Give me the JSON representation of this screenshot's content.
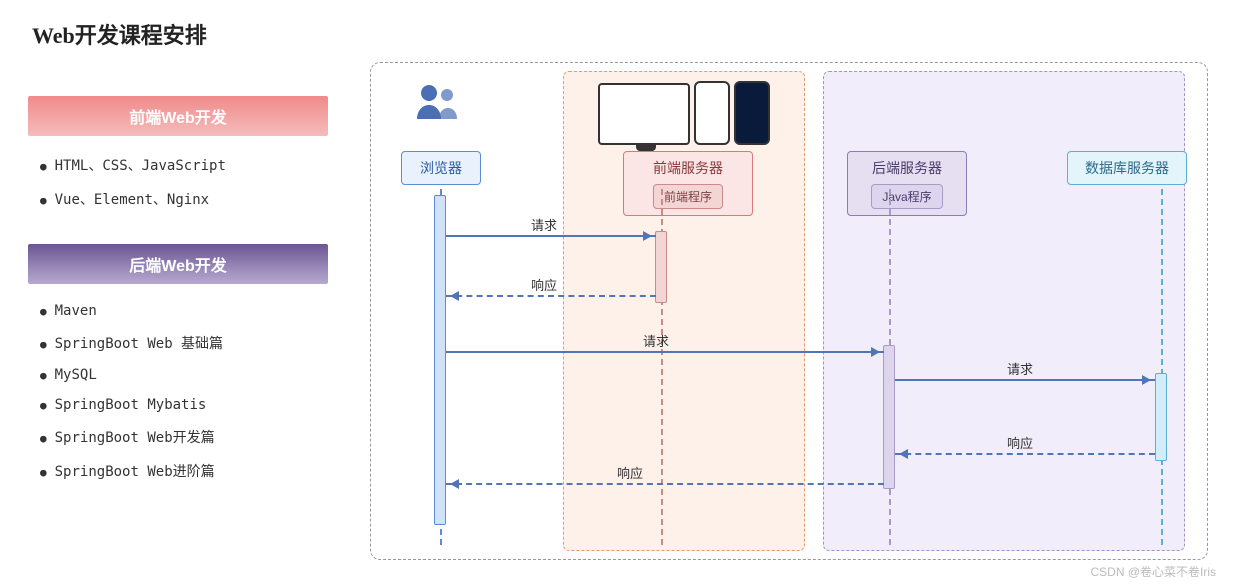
{
  "title": "Web开发课程安排",
  "frontend_section": {
    "header": "前端Web开发",
    "items": [
      "HTML、CSS、JavaScript",
      "Vue、Element、Nginx"
    ]
  },
  "backend_section": {
    "header": "后端Web开发",
    "items": [
      "Maven",
      "SpringBoot Web 基础篇",
      "MySQL",
      "SpringBoot Mybatis",
      "SpringBoot Web开发篇",
      "SpringBoot Web进阶篇"
    ]
  },
  "nodes": {
    "browser": "浏览器",
    "frontend_server": "前端服务器",
    "frontend_program": "前端程序",
    "backend_server": "后端服务器",
    "backend_program": "Java程序",
    "db_server": "数据库服务器"
  },
  "arrows": {
    "req1": "请求",
    "res1": "响应",
    "req2": "请求",
    "req3": "请求",
    "res2": "响应",
    "res3": "响应"
  },
  "watermark": "CSDN @卷心菜不卷Iris",
  "chart_data": {
    "type": "sequence-diagram",
    "title": "Web开发课程安排",
    "participants": [
      {
        "id": "browser",
        "label": "浏览器",
        "zone": null
      },
      {
        "id": "frontend",
        "label": "前端服务器",
        "sublabel": "前端程序",
        "zone": "frontend"
      },
      {
        "id": "backend",
        "label": "后端服务器",
        "sublabel": "Java程序",
        "zone": "backend"
      },
      {
        "id": "database",
        "label": "数据库服务器",
        "zone": "backend"
      }
    ],
    "zones": [
      {
        "id": "frontend",
        "color": "#fef1ea"
      },
      {
        "id": "backend",
        "color": "#f2edfa"
      }
    ],
    "messages": [
      {
        "from": "browser",
        "to": "frontend",
        "label": "请求",
        "style": "solid"
      },
      {
        "from": "frontend",
        "to": "browser",
        "label": "响应",
        "style": "dashed"
      },
      {
        "from": "browser",
        "to": "backend",
        "label": "请求",
        "style": "solid"
      },
      {
        "from": "backend",
        "to": "database",
        "label": "请求",
        "style": "solid"
      },
      {
        "from": "database",
        "to": "backend",
        "label": "响应",
        "style": "dashed"
      },
      {
        "from": "backend",
        "to": "browser",
        "label": "响应",
        "style": "dashed"
      }
    ]
  }
}
